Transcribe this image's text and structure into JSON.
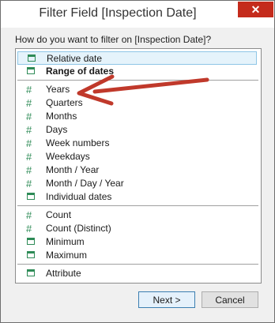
{
  "window": {
    "title": "Filter Field [Inspection Date]",
    "close_glyph": "✕"
  },
  "prompt": "How do you want to filter on [Inspection Date]?",
  "list": {
    "group1": [
      {
        "label": "Relative date",
        "icon": "calendar-icon",
        "selected": true
      },
      {
        "label": "Range of dates",
        "icon": "calendar-icon",
        "bold": true
      }
    ],
    "group2": [
      {
        "label": "Years",
        "icon": "hash-icon"
      },
      {
        "label": "Quarters",
        "icon": "hash-icon"
      },
      {
        "label": "Months",
        "icon": "hash-icon"
      },
      {
        "label": "Days",
        "icon": "hash-icon"
      },
      {
        "label": "Week numbers",
        "icon": "hash-icon"
      },
      {
        "label": "Weekdays",
        "icon": "hash-icon"
      },
      {
        "label": "Month / Year",
        "icon": "hash-icon"
      },
      {
        "label": "Month / Day / Year",
        "icon": "hash-icon"
      },
      {
        "label": "Individual dates",
        "icon": "calendar-icon"
      }
    ],
    "group3": [
      {
        "label": "Count",
        "icon": "hash-icon"
      },
      {
        "label": "Count (Distinct)",
        "icon": "hash-icon"
      },
      {
        "label": "Minimum",
        "icon": "calendar-icon"
      },
      {
        "label": "Maximum",
        "icon": "calendar-icon"
      }
    ],
    "group4": [
      {
        "label": "Attribute",
        "icon": "calendar-icon"
      }
    ]
  },
  "buttons": {
    "next": "Next >",
    "cancel": "Cancel"
  },
  "annotation": {
    "arrow_color": "#c0392b"
  }
}
